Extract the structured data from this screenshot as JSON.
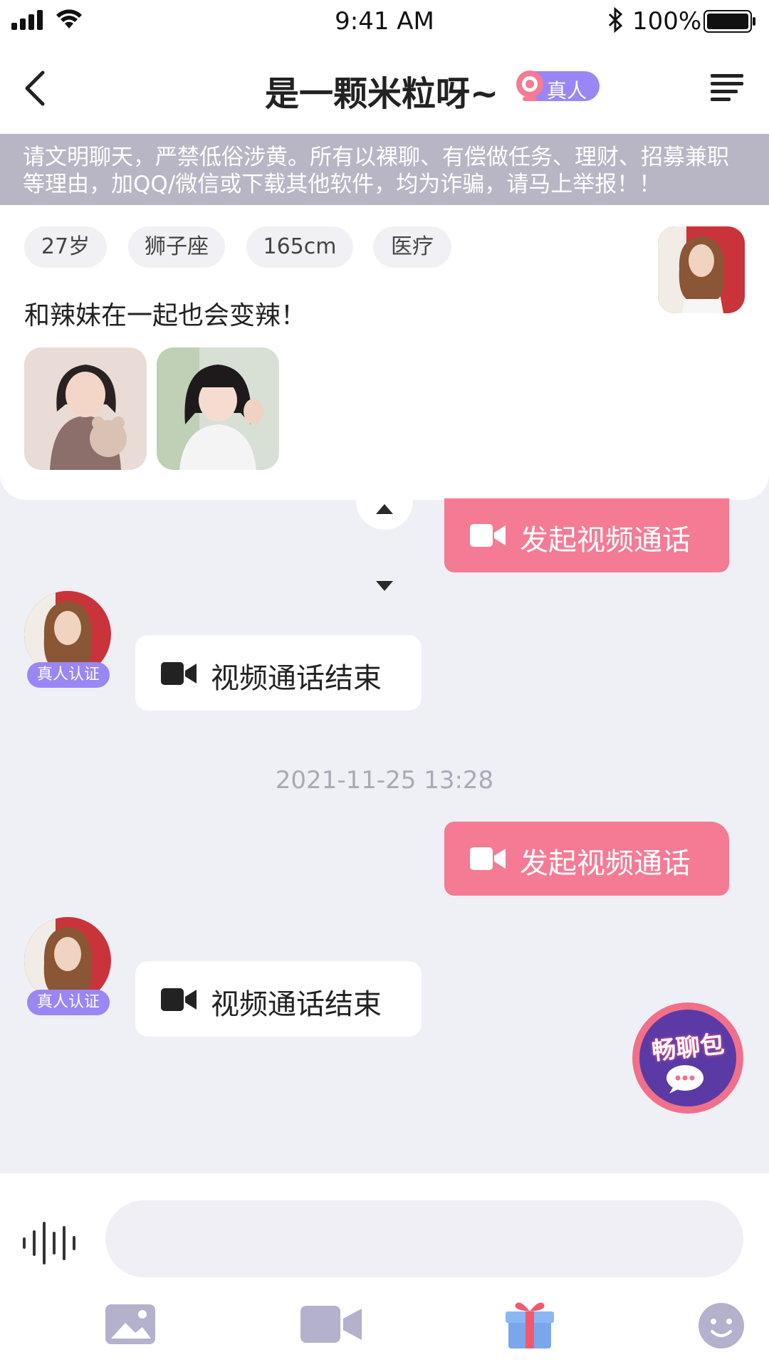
{
  "status_bar": {
    "time": "9:41 AM",
    "battery": "100%"
  },
  "header": {
    "title": "是一颗米粒呀~",
    "badge": "真人"
  },
  "notice": "请文明聊天，严禁低俗涉黄。所有以裸聊、有偿做任务、理财、招募兼职等理由，加QQ/微信或下载其他软件，均为诈骗，请马上举报！！",
  "profile": {
    "tags": [
      "27岁",
      "狮子座",
      "165cm",
      "医疗"
    ],
    "bio": "和辣妹在一起也会变辣！"
  },
  "messages": {
    "outgoing_1": "发起视频通话",
    "incoming_1": "视频通话结束",
    "verify_1": "真人认证",
    "timestamp": "2021-11-25 13:28",
    "outgoing_2": "发起视频通话",
    "incoming_2": "视频通话结束",
    "verify_2": "真人认证"
  },
  "float_badge": "畅聊包",
  "input": {
    "value": ""
  },
  "colors": {
    "accent_pink": "#f57a94",
    "accent_purple": "#9b86f5",
    "notice_bg": "#b8b6c5",
    "chat_bg": "#efeff6"
  },
  "icons": {
    "toolbar": [
      "image-icon",
      "video-icon",
      "gift-icon",
      "emoji-icon"
    ],
    "header": [
      "back-icon",
      "menu-icon"
    ]
  }
}
